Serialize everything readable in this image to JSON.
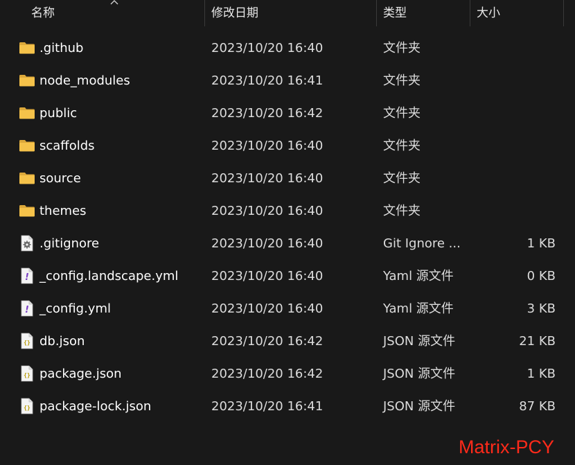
{
  "columns": {
    "name": "名称",
    "modified": "修改日期",
    "type": "类型",
    "size": "大小"
  },
  "files": [
    {
      "name": ".github",
      "modified": "2023/10/20 16:40",
      "type": "文件夹",
      "size": "",
      "icon": "folder-icon"
    },
    {
      "name": "node_modules",
      "modified": "2023/10/20 16:41",
      "type": "文件夹",
      "size": "",
      "icon": "folder-icon"
    },
    {
      "name": "public",
      "modified": "2023/10/20 16:42",
      "type": "文件夹",
      "size": "",
      "icon": "folder-icon"
    },
    {
      "name": "scaffolds",
      "modified": "2023/10/20 16:40",
      "type": "文件夹",
      "size": "",
      "icon": "folder-icon"
    },
    {
      "name": "source",
      "modified": "2023/10/20 16:40",
      "type": "文件夹",
      "size": "",
      "icon": "folder-icon"
    },
    {
      "name": "themes",
      "modified": "2023/10/20 16:40",
      "type": "文件夹",
      "size": "",
      "icon": "folder-icon"
    },
    {
      "name": ".gitignore",
      "modified": "2023/10/20 16:40",
      "type": "Git Ignore ...",
      "size": "1 KB",
      "icon": "gear-file-icon"
    },
    {
      "name": "_config.landscape.yml",
      "modified": "2023/10/20 16:40",
      "type": "Yaml 源文件",
      "size": "0 KB",
      "icon": "yaml-file-icon"
    },
    {
      "name": "_config.yml",
      "modified": "2023/10/20 16:40",
      "type": "Yaml 源文件",
      "size": "3 KB",
      "icon": "yaml-file-icon"
    },
    {
      "name": "db.json",
      "modified": "2023/10/20 16:42",
      "type": "JSON 源文件",
      "size": "21 KB",
      "icon": "json-file-icon"
    },
    {
      "name": "package.json",
      "modified": "2023/10/20 16:42",
      "type": "JSON 源文件",
      "size": "1 KB",
      "icon": "json-file-icon"
    },
    {
      "name": "package-lock.json",
      "modified": "2023/10/20 16:41",
      "type": "JSON 源文件",
      "size": "87 KB",
      "icon": "json-file-icon"
    }
  ],
  "watermark": "Matrix-PCY",
  "colors": {
    "background": "#191919",
    "folder": "#f5c24a",
    "watermark": "#ff2a1a"
  }
}
